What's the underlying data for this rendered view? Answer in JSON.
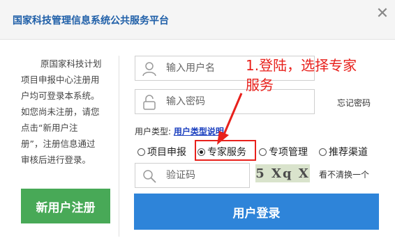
{
  "header": {
    "title": "国家科技管理信息系统公共服务平台",
    "close_icon": "close-icon"
  },
  "intro": {
    "lines": [
      "原国家科技计划",
      "项目申报中心注册用",
      "户均可登录本系统。",
      "如您尚未注册，请您",
      "点击“新用户注",
      "册”，注册信息通过",
      "审核后进行登录。"
    ]
  },
  "register_button": "新用户注册",
  "form": {
    "username_placeholder": "输入用户名",
    "password_placeholder": "输入密码",
    "forgot_password": "忘记密码",
    "user_type_label": "用户类型:",
    "user_type_link": "用户类型说明",
    "user_types": [
      {
        "label": "项目申报",
        "selected": false
      },
      {
        "label": "专家服务",
        "selected": true
      },
      {
        "label": "专项管理",
        "selected": false
      },
      {
        "label": "推荐渠道",
        "selected": false
      }
    ],
    "captcha_placeholder": "验证码",
    "captcha_text": "5 Xq X",
    "refresh_captcha": "看不清换一个",
    "login_button": "用户登录"
  },
  "annotation": {
    "text_line1": "1.登陆，选择专家",
    "text_line2": "服务",
    "color": "#e8211c"
  },
  "colors": {
    "register_green": "#48a957",
    "login_blue": "#2e84d9",
    "title_blue": "#1f5fa8"
  }
}
